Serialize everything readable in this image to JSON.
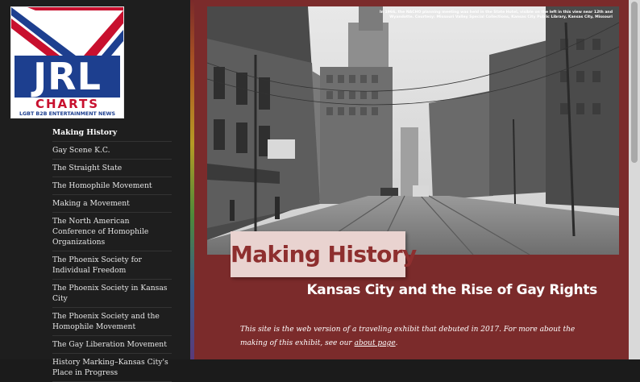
{
  "logo": {
    "brand": "JRL",
    "word": "CHARTS",
    "tagline": "LGBT B2B ENTERTAINMENT NEWS"
  },
  "nav": {
    "items": [
      {
        "label": "Making History",
        "active": true
      },
      {
        "label": "Gay Scene K.C."
      },
      {
        "label": "The Straight State"
      },
      {
        "label": "The Homophile Movement"
      },
      {
        "label": "Making a Movement"
      },
      {
        "label": "The North American Conference of Homophile Organizations"
      },
      {
        "label": "The Phoenix Society for Individual Freedom"
      },
      {
        "label": "The Phoenix Society in Kansas City"
      },
      {
        "label": "The Phoenix Society and the Homophile Movement"
      },
      {
        "label": "The Gay Liberation Movement"
      },
      {
        "label": "History Marking–Kansas City's Place in Progress"
      }
    ]
  },
  "hero": {
    "caption": "In 1966, the NACHO planning meeting was held in the State Hotel, visible on the left in this view near 12th and Wyandotte. Courtesy: Missouri Valley Special Collections, Kansas City Public Library, Kansas City, Missouri",
    "title": "Making History",
    "subtitle": "Kansas City and the Rise of Gay Rights"
  },
  "intro": {
    "before": "This site is the web version of a traveling exhibit that debuted in 2017. For more about the making of this exhibit, see our ",
    "link": "about page",
    "after": "."
  },
  "colors": {
    "accent": "#7b2b2b",
    "title_box": "#e9d3d0",
    "title_text": "#8e2f2f",
    "sidebar": "#1e1e1e"
  }
}
